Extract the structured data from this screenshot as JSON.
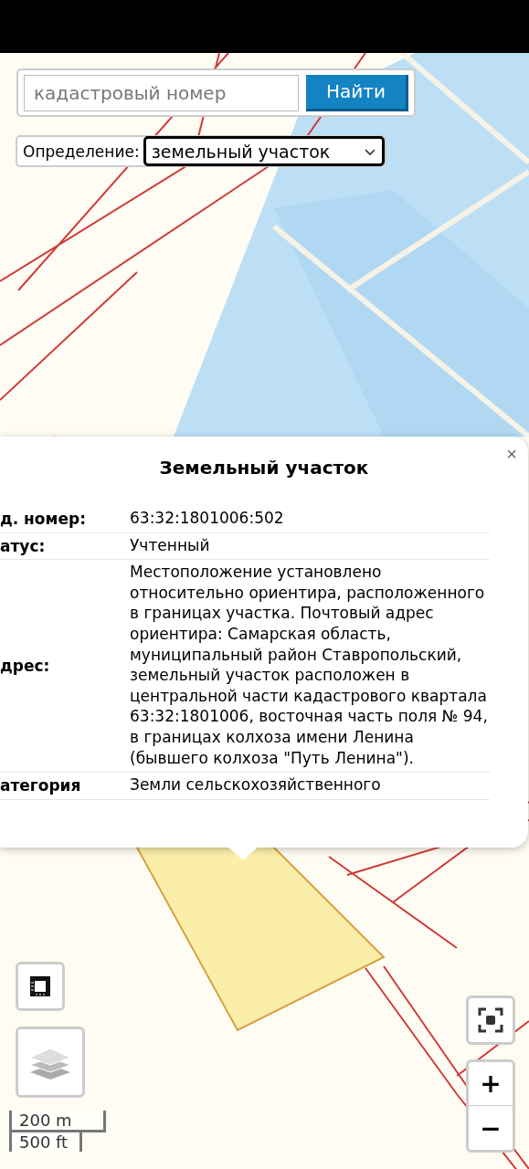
{
  "search": {
    "placeholder": "кадастровый номер",
    "button": "Найти"
  },
  "definition": {
    "label": "Определение:",
    "value": "земельный участок"
  },
  "popup": {
    "title": "Земельный участок",
    "close": "×",
    "rows": [
      {
        "label": "д. номер:",
        "value": "63:32:1801006:502"
      },
      {
        "label": "атус:",
        "value": "Учтенный"
      },
      {
        "label": "дрес:",
        "value": "Местоположение установлено относительно ориентира, расположенного в границах участка. Почтовый адрес ориентира: Самарская область, муниципальный район Ставропольский, земельный участок расположен в центральной части кадастрового квартала 63:32:1801006, восточная часть поля № 94, в границах колхоза имени Ленина (бывшего колхоза \"Путь Ленина\")."
      },
      {
        "label": "атегория",
        "value": "Земли сельскохозяйственного"
      }
    ]
  },
  "zoom": {
    "in": "+",
    "out": "−"
  },
  "scale": {
    "metric": "200 m",
    "imperial": "500 ft"
  }
}
